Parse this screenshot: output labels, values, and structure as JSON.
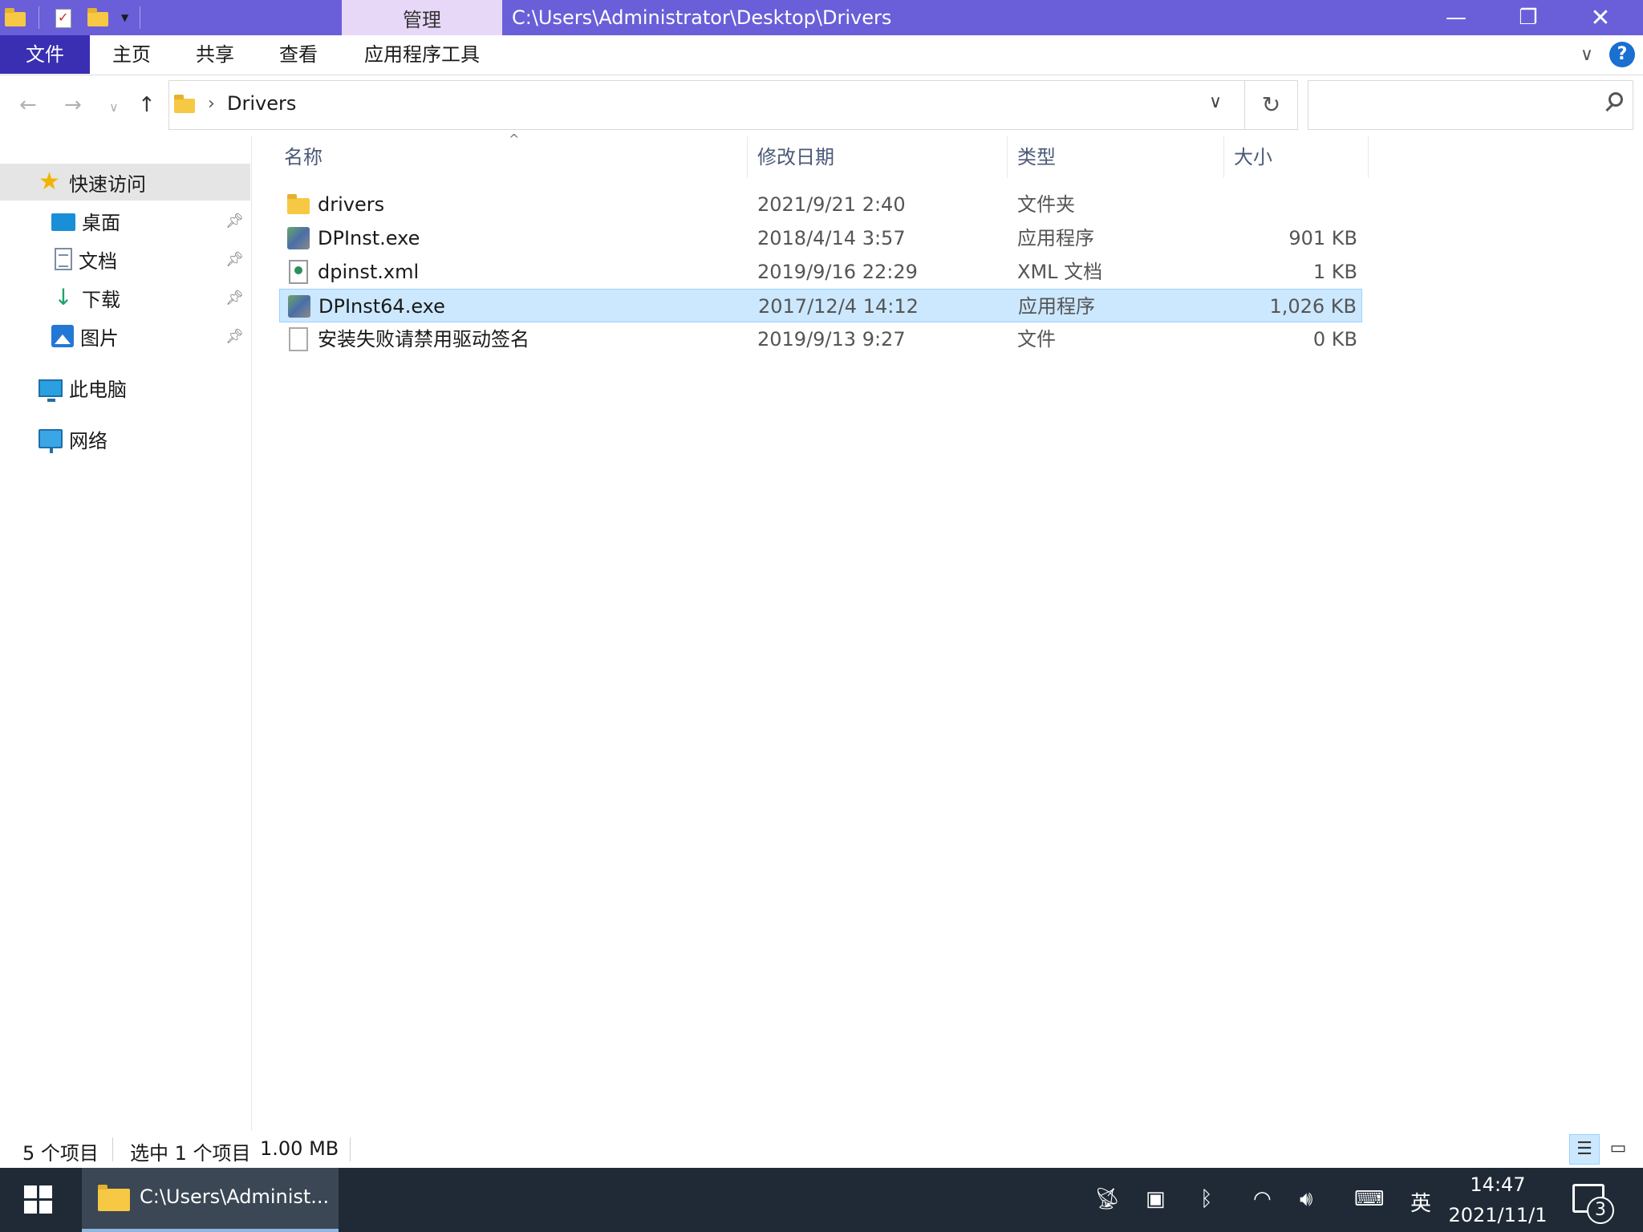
{
  "titlebar": {
    "manage_tab": "管理",
    "path": "C:\\Users\\Administrator\\Desktop\\Drivers",
    "accent_color": "#6a5fd8"
  },
  "ribbon": {
    "tabs": [
      {
        "label": "文件"
      },
      {
        "label": "主页"
      },
      {
        "label": "共享"
      },
      {
        "label": "查看"
      },
      {
        "label": "应用程序工具"
      }
    ],
    "help_label": "?"
  },
  "address": {
    "current_folder": "Drivers",
    "search_placeholder": ""
  },
  "sidebar": {
    "quick_access": "快速访问",
    "items": [
      {
        "label": "桌面",
        "icon": "desktop-icon"
      },
      {
        "label": "文档",
        "icon": "document-icon"
      },
      {
        "label": "下载",
        "icon": "download-icon"
      },
      {
        "label": "图片",
        "icon": "pictures-icon"
      }
    ],
    "this_pc": "此电脑",
    "network": "网络"
  },
  "columns": {
    "name": "名称",
    "date": "修改日期",
    "type": "类型",
    "size": "大小"
  },
  "files": [
    {
      "name": "drivers",
      "date": "2021/9/21 2:40",
      "type": "文件夹",
      "size": "",
      "icon": "folder-icon"
    },
    {
      "name": "DPInst.exe",
      "date": "2018/4/14 3:57",
      "type": "应用程序",
      "size": "901 KB",
      "icon": "exe-icon"
    },
    {
      "name": "dpinst.xml",
      "date": "2019/9/16 22:29",
      "type": "XML 文档",
      "size": "1 KB",
      "icon": "xml-icon"
    },
    {
      "name": "DPInst64.exe",
      "date": "2017/12/4 14:12",
      "type": "应用程序",
      "size": "1,026 KB",
      "icon": "exe-icon",
      "selected": true
    },
    {
      "name": "安装失败请禁用驱动签名",
      "date": "2019/9/13 9:27",
      "type": "文件",
      "size": "0 KB",
      "icon": "file-icon"
    }
  ],
  "status": {
    "item_count": "5 个项目",
    "selected": "选中 1 个项目",
    "selected_size": "1.00 MB"
  },
  "taskbar": {
    "app_label": "C:\\Users\\Administ...",
    "ime": "英",
    "time": "14:47",
    "date": "2021/11/1",
    "notifications": "3"
  }
}
